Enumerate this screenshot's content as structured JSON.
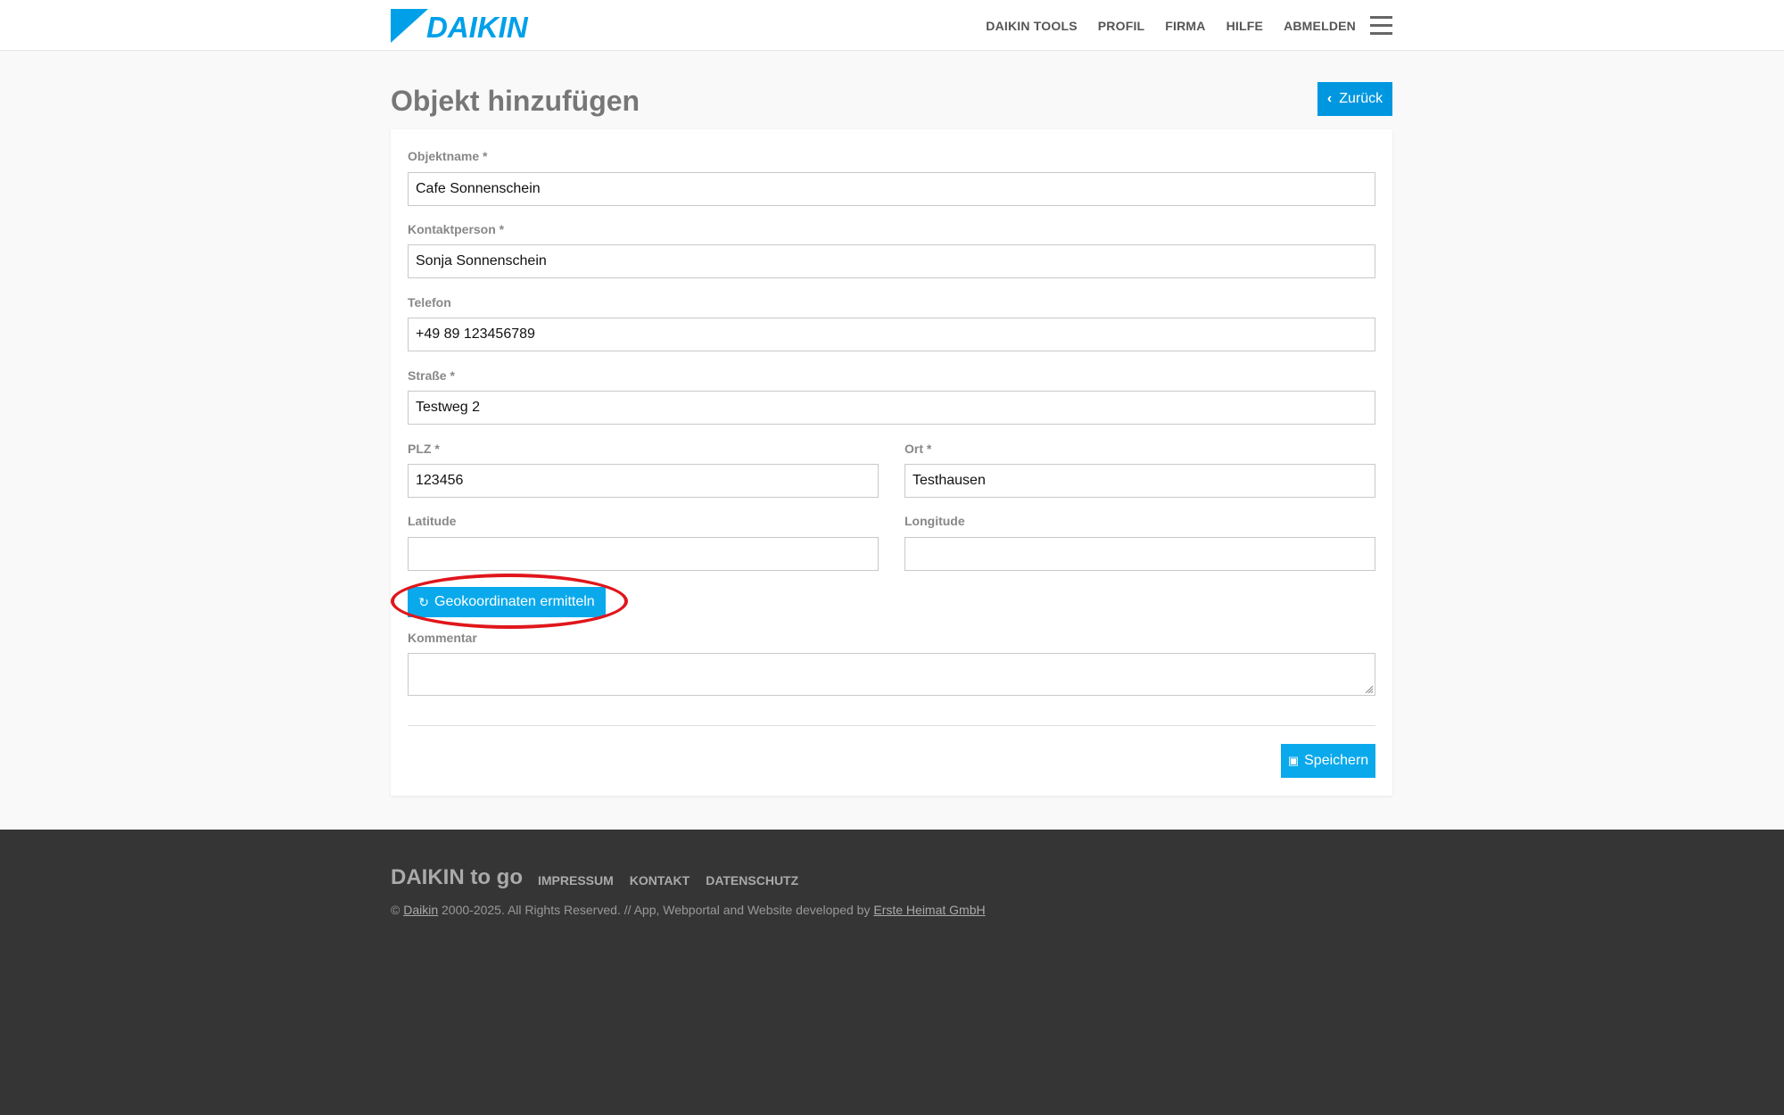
{
  "header": {
    "logo_text": "DAIKIN",
    "nav": [
      "DAIKIN TOOLS",
      "PROFIL",
      "FIRMA",
      "HILFE",
      "ABMELDEN"
    ]
  },
  "page": {
    "title": "Objekt hinzufügen",
    "back_label": "Zurück"
  },
  "form": {
    "objektname": {
      "label": "Objektname *",
      "value": "Cafe Sonnenschein"
    },
    "kontaktperson": {
      "label": "Kontaktperson *",
      "value": "Sonja Sonnenschein"
    },
    "telefon": {
      "label": "Telefon",
      "value": "+49 89 123456789"
    },
    "strasse": {
      "label": "Straße *",
      "value": "Testweg 2"
    },
    "plz": {
      "label": "PLZ *",
      "value": "123456"
    },
    "ort": {
      "label": "Ort *",
      "value": "Testhausen"
    },
    "latitude": {
      "label": "Latitude",
      "value": ""
    },
    "longitude": {
      "label": "Longitude",
      "value": ""
    },
    "geo_button": "Geokoordinaten ermitteln",
    "kommentar": {
      "label": "Kommentar",
      "value": ""
    },
    "save_button": "Speichern"
  },
  "footer": {
    "brand": "DAIKIN to go",
    "links": [
      "IMPRESSUM",
      "KONTAKT",
      "DATENSCHUTZ"
    ],
    "copy_prefix": "©",
    "copy_link1": "Daikin",
    "copy_middle": "2000-2025. All Rights Reserved. // App, Webportal and Website developed by",
    "copy_link2": "Erste Heimat GmbH"
  },
  "colors": {
    "accent": "#0aa9ec",
    "highlight": "#e0161b",
    "footer_bg": "#353535"
  },
  "icons": {
    "back": "chevron-left-icon",
    "geo": "refresh-icon",
    "save": "floppy-disk-icon",
    "menu": "hamburger-menu-icon"
  }
}
